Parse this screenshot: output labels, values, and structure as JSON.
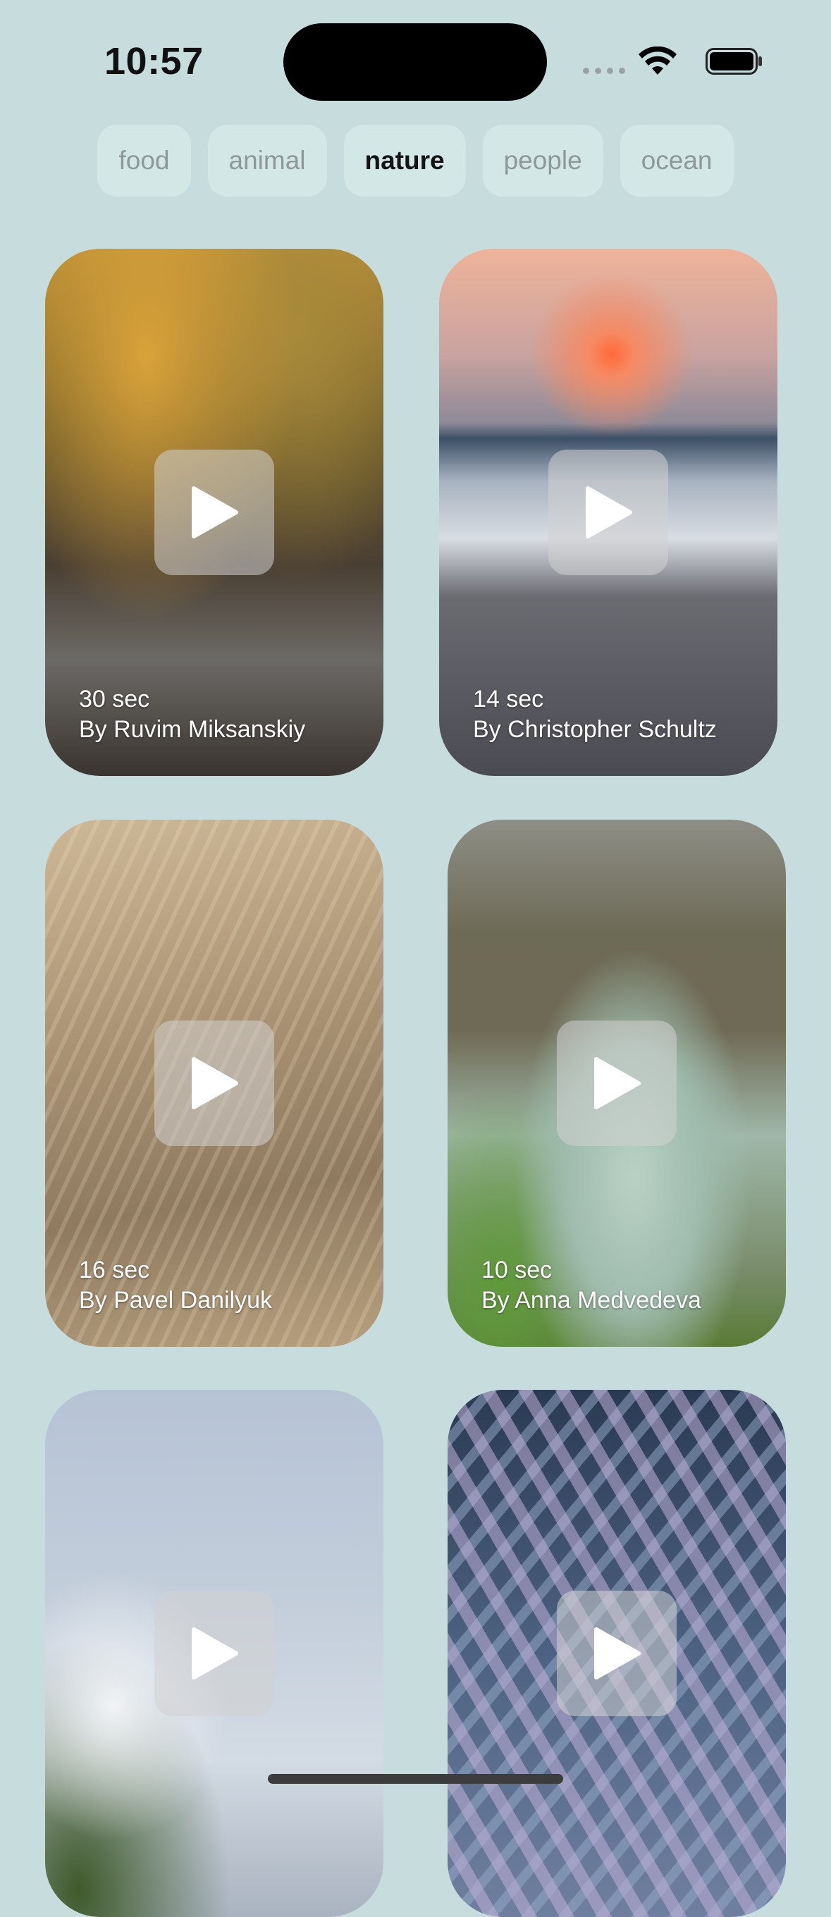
{
  "status_bar": {
    "time": "10:57"
  },
  "tabs": [
    {
      "label": "food",
      "active": false
    },
    {
      "label": "animal",
      "active": false
    },
    {
      "label": "nature",
      "active": true
    },
    {
      "label": "people",
      "active": false
    },
    {
      "label": "ocean",
      "active": false
    }
  ],
  "videos": [
    {
      "duration": "30 sec",
      "author": "By Ruvim Miksanskiy"
    },
    {
      "duration": "14 sec",
      "author": "By Christopher Schultz"
    },
    {
      "duration": "16 sec",
      "author": "By Pavel Danilyuk"
    },
    {
      "duration": "10 sec",
      "author": "By Anna Medvedeva"
    },
    {
      "duration": "",
      "author": ""
    },
    {
      "duration": "",
      "author": ""
    }
  ],
  "icons": {
    "play": "play-icon",
    "wifi": "wifi-icon",
    "battery": "battery-icon",
    "signal": "cellular-signal-icon"
  }
}
